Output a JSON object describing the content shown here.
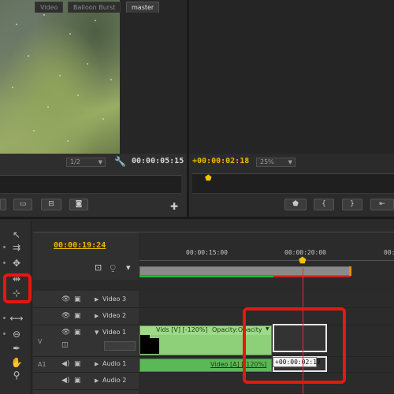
{
  "source_monitor": {
    "zoom": "1/2",
    "duration_timecode": "00:00:05:15"
  },
  "program_monitor": {
    "current_timecode": "+00:00:02:18",
    "zoom": "25%"
  },
  "timeline": {
    "tabs": [
      {
        "label": "Video",
        "active": false
      },
      {
        "label": "Balloon Burst",
        "active": false
      },
      {
        "label": "master",
        "active": true
      }
    ],
    "current_timecode": "00:00:19:24",
    "ruler_labels": [
      "00:00:15:00",
      "00:00:20:00",
      "00:0"
    ],
    "tracks": {
      "video3": {
        "name": "Video 3"
      },
      "video2": {
        "name": "Video 2"
      },
      "video1": {
        "name": "Video 1",
        "side_label": "V"
      },
      "audio1": {
        "name": "Audio 1",
        "side_label": "A1"
      },
      "audio2": {
        "name": "Audio 2"
      }
    },
    "video_clip_label": "Vids [V] [-120%]",
    "video_clip_effect": "Opacity:Opacity",
    "audio_clip_label": "Video [A] [-120%]",
    "drag_tooltip": "+00:00:02:19"
  },
  "icons": [
    "selection-tool-icon",
    "track-select-tool-icon",
    "ripple-edit-tool-icon",
    "rate-stretch-tool-icon",
    "razor-tool-icon",
    "slip-tool-icon",
    "pen-tool-icon",
    "hand-tool-icon",
    "zoom-tool-icon",
    "wrench-icon",
    "eye-icon",
    "film-icon",
    "speaker-icon",
    "plus-icon"
  ],
  "colors": {
    "timecode_yellow": "#f2b800",
    "video_clip": "#8ed07a",
    "audio_clip": "#5bb856",
    "playhead": "#dd3333",
    "highlight": "#e8170e"
  }
}
